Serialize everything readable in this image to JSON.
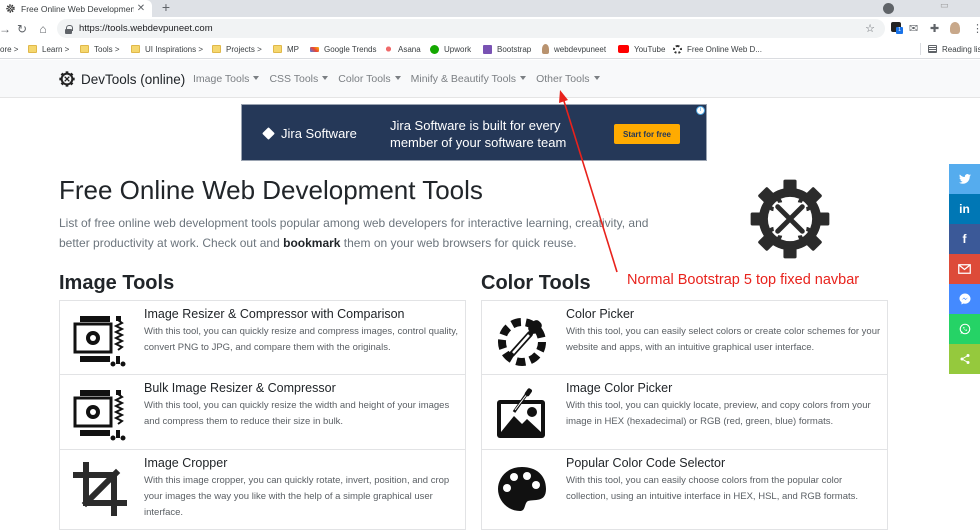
{
  "browser": {
    "tab_title": "Free Online Web Development To",
    "new_tab": "+",
    "close": "✕",
    "url": "https://tools.webdevpuneet.com",
    "bookmarks": [
      {
        "label": "ore >",
        "type": "text"
      },
      {
        "label": "Learn >",
        "type": "folder"
      },
      {
        "label": "Tools >",
        "type": "folder"
      },
      {
        "label": "UI Inspirations >",
        "type": "folder"
      },
      {
        "label": "Projects >",
        "type": "folder"
      },
      {
        "label": "MP",
        "type": "folder"
      },
      {
        "label": "Google Trends",
        "type": "trends"
      },
      {
        "label": "Asana",
        "type": "asana"
      },
      {
        "label": "Upwork",
        "type": "upwork"
      },
      {
        "label": "Bootstrap",
        "type": "bootstrap"
      },
      {
        "label": "webdevpuneet",
        "type": "avatar"
      },
      {
        "label": "YouTube",
        "type": "youtube"
      },
      {
        "label": "Free Online Web D...",
        "type": "gear"
      }
    ],
    "reading_list": "Reading list",
    "extension_badge": "1"
  },
  "navbar": {
    "brand": "DevTools (online)",
    "links": [
      "Image Tools",
      "CSS Tools",
      "Color Tools",
      "Minify & Beautify Tools",
      "Other Tools"
    ]
  },
  "ad": {
    "brand": "Jira Software",
    "headline": "Jira Software is built for every member of your software team",
    "cta": "Start for free",
    "info": "i"
  },
  "hero": {
    "title": "Free Online Web Development Tools",
    "lead_before": "List of free online web development tools popular among web developers for interactive learning, creativity, and better productivity at work. Check out and ",
    "lead_bold": "bookmark",
    "lead_after": " them on your web browsers for quick reuse."
  },
  "annotation": "Normal Bootstrap 5 top fixed navbar",
  "sections": {
    "image": {
      "title": "Image Tools",
      "cards": [
        {
          "title": "Image Resizer & Compressor with Comparison",
          "desc": "With this tool, you can quickly resize and compress images, control quality, convert PNG to JPG, and compare them with the originals.",
          "icon": "image-compress-icon"
        },
        {
          "title": "Bulk Image Resizer & Compressor",
          "desc": "With this tool, you can quickly resize the width and height of your images and compress them to reduce their size in bulk.",
          "icon": "bulk-image-compress-icon"
        },
        {
          "title": "Image Cropper",
          "desc": "With this image cropper, you can quickly rotate, invert, position, and crop your images the way you like with the help of a simple graphical user interface.",
          "icon": "crop-icon"
        }
      ]
    },
    "color": {
      "title": "Color Tools",
      "cards": [
        {
          "title": "Color Picker",
          "desc": "With this tool, you can easily select colors or create color schemes for your website and apps, with an intuitive graphical user interface.",
          "icon": "eyedropper-icon"
        },
        {
          "title": "Image Color Picker",
          "desc": "With this tool, you can quickly locate, preview, and copy colors from your image in HEX (hexadecimal) or RGB (red, green, blue) formats.",
          "icon": "image-eyedropper-icon"
        },
        {
          "title": "Popular Color Code Selector",
          "desc": "With this tool, you can easily choose colors from the popular color collection, using an intuitive interface in HEX, HSL, and RGB formats.",
          "icon": "palette-icon"
        }
      ]
    }
  },
  "share": [
    {
      "name": "twitter",
      "glyph": "🐦",
      "color": "#55acee"
    },
    {
      "name": "linkedin",
      "glyph": "in",
      "color": "#0077b5"
    },
    {
      "name": "facebook",
      "glyph": "f",
      "color": "#3b5998"
    },
    {
      "name": "gmail",
      "glyph": "✉",
      "color": "#dd4b39"
    },
    {
      "name": "messenger",
      "glyph": "💬",
      "color": "#448aff"
    },
    {
      "name": "whatsapp",
      "glyph": "✆",
      "color": "#25d366"
    },
    {
      "name": "share",
      "glyph": "<",
      "color": "#95c93d"
    }
  ],
  "colors": {
    "annotation": "#e8221c",
    "ad_bg": "#253858",
    "ad_cta": "#ffab00"
  }
}
